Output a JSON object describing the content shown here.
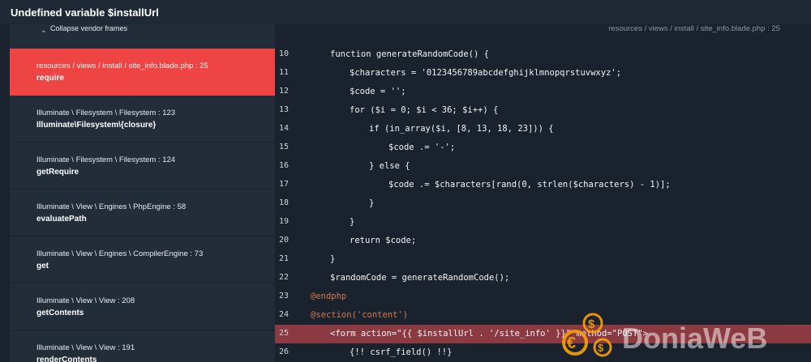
{
  "header": {
    "title": "Undefined variable $installUrl"
  },
  "sidebar": {
    "collapse_icon": "collapse-icon",
    "collapse_label": "Collapse vendor frames",
    "frames": [
      {
        "path": "resources / views / install / ",
        "file": "site_info.blade.php",
        "line_sep": " : 25",
        "method": "require",
        "active": true
      },
      {
        "path": "Illuminate \\ Filesystem \\ Filesystem",
        "file": "",
        "line_sep": " : 123",
        "method": "Illuminate\\Filesystem\\{closure}",
        "active": false
      },
      {
        "path": "Illuminate \\ Filesystem \\ Filesystem",
        "file": "",
        "line_sep": " : 124",
        "method": "getRequire",
        "active": false
      },
      {
        "path": "Illuminate \\ View \\ Engines \\ PhpEngine",
        "file": "",
        "line_sep": " : 58",
        "method": "evaluatePath",
        "active": false
      },
      {
        "path": "Illuminate \\ View \\ Engines \\ CompilerEngine",
        "file": "",
        "line_sep": " : 73",
        "method": "get",
        "active": false
      },
      {
        "path": "Illuminate \\ View \\ View",
        "file": "",
        "line_sep": " : 208",
        "method": "getContents",
        "active": false
      },
      {
        "path": "Illuminate \\ View \\ View",
        "file": "",
        "line_sep": " : 191",
        "method": "renderContents",
        "active": false
      }
    ]
  },
  "code": {
    "file_path": "resources / views / install / site_info.blade.php : 25",
    "lines": [
      {
        "num": "10",
        "indent": 1,
        "text": "function generateRandomCode() {",
        "kind": "normal"
      },
      {
        "num": "11",
        "indent": 2,
        "text": "$characters = '0123456789abcdefghijklmnopqrstuvwxyz';",
        "kind": "normal"
      },
      {
        "num": "12",
        "indent": 2,
        "text": "$code = '';",
        "kind": "normal"
      },
      {
        "num": "13",
        "indent": 2,
        "text": "for ($i = 0; $i < 36; $i++) {",
        "kind": "normal"
      },
      {
        "num": "14",
        "indent": 3,
        "text": "if (in_array($i, [8, 13, 18, 23])) {",
        "kind": "normal"
      },
      {
        "num": "15",
        "indent": 4,
        "text": "$code .= '-';",
        "kind": "normal"
      },
      {
        "num": "16",
        "indent": 3,
        "text": "} else {",
        "kind": "normal"
      },
      {
        "num": "17",
        "indent": 4,
        "text": "$code .= $characters[rand(0, strlen($characters) - 1)];",
        "kind": "normal"
      },
      {
        "num": "18",
        "indent": 3,
        "text": "}",
        "kind": "normal"
      },
      {
        "num": "19",
        "indent": 2,
        "text": "}",
        "kind": "normal"
      },
      {
        "num": "20",
        "indent": 2,
        "text": "return $code;",
        "kind": "normal"
      },
      {
        "num": "21",
        "indent": 1,
        "text": "}",
        "kind": "normal"
      },
      {
        "num": "22",
        "indent": 1,
        "text": "$randomCode = generateRandomCode();",
        "kind": "normal"
      },
      {
        "num": "23",
        "indent": 0,
        "text": "@endphp",
        "kind": "directive"
      },
      {
        "num": "24",
        "indent": 0,
        "text": "@section('content')",
        "kind": "section"
      },
      {
        "num": "25",
        "indent": 1,
        "text": "<form action=\"{{ $installUrl . '/site_info' }}\" method=\"POST\">",
        "kind": "highlight"
      },
      {
        "num": "26",
        "indent": 2,
        "text": "{!! csrf_field() !!}",
        "kind": "blade"
      }
    ]
  },
  "watermark": {
    "text": "DoniaWeB",
    "icon": "euro-dollar-logo-icon"
  },
  "colors": {
    "active_frame": "#ef4444",
    "highlight_line": "#8b3a41",
    "sidebar_bg": "#232d3a",
    "code_bg": "#1a222d",
    "directive": "#d07a4a",
    "logo_orange": "#f59e0b"
  }
}
